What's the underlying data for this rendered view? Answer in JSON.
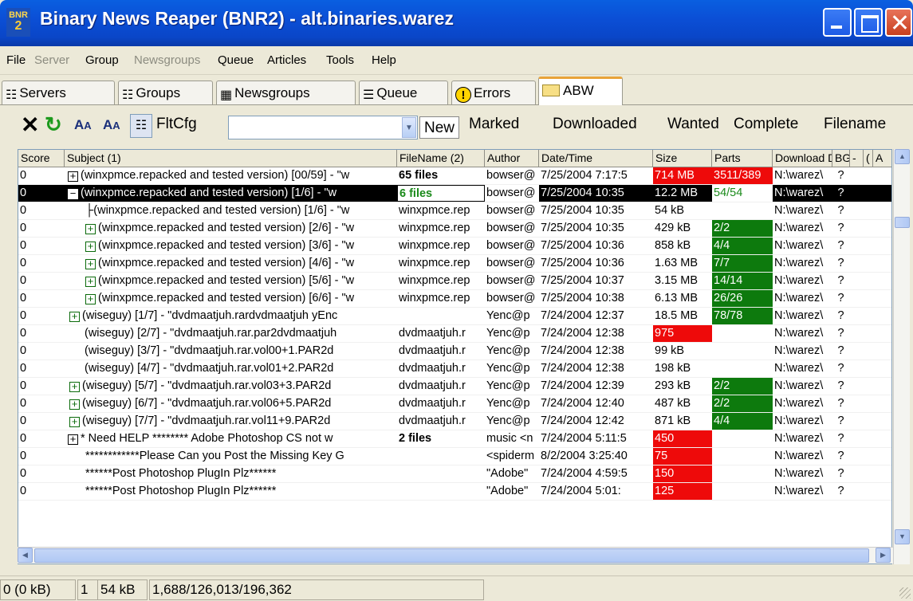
{
  "window": {
    "title": "Binary News Reaper (BNR2) - alt.binaries.warez",
    "icon_text_top": "BNR",
    "icon_text_bottom": "2"
  },
  "menu": [
    {
      "label": "File",
      "disabled": false
    },
    {
      "label": "Server",
      "disabled": true
    },
    {
      "label": "Group",
      "disabled": false
    },
    {
      "label": "Newsgroups",
      "disabled": true
    },
    {
      "label": "Queue",
      "disabled": false
    },
    {
      "label": "Articles",
      "disabled": false
    },
    {
      "label": "Tools",
      "disabled": false
    },
    {
      "label": "Help",
      "disabled": false
    }
  ],
  "tabs": [
    {
      "label": "Servers",
      "icon": "servers-icon"
    },
    {
      "label": "Groups",
      "icon": "groups-icon"
    },
    {
      "label": "Newsgroups",
      "icon": "newsgroups-icon"
    },
    {
      "label": "Queue",
      "icon": "queue-icon"
    },
    {
      "label": "Errors",
      "icon": "error-icon"
    },
    {
      "label": "ABW",
      "icon": "folder-icon",
      "active": true
    }
  ],
  "toolbar": {
    "filter_config_label": "FltCfg",
    "filter_value": "",
    "new_label": "New",
    "filters": [
      "Marked",
      "Downloaded",
      "Wanted",
      "Complete",
      "Filename"
    ]
  },
  "grid": {
    "columns": [
      "Score",
      "Subject (1)",
      "FileName (2)",
      "Author",
      "Date/Time",
      "Size",
      "Parts",
      "Download D",
      "BG",
      "-",
      "(",
      "A"
    ],
    "rows": [
      {
        "score": "0",
        "subject": "(winxpmce.repacked and tested version) [00/59] - \"w",
        "expander": "+",
        "filename": "65 files",
        "author": "bowser@",
        "date": "7/25/2004 7:17:5",
        "size": "714 MB",
        "size_color": "red",
        "parts": "3511/389",
        "parts_color": "red",
        "dl": "N:\\warez\\",
        "bg": "?"
      },
      {
        "score": "0",
        "subject": "(winxpmce.repacked and tested version) [1/6] - \"w",
        "expander": "-",
        "filename": "6 files",
        "author": "bowser@",
        "date": "7/25/2004 10:35",
        "size": "12.2 MB",
        "size_color": "",
        "parts": "54/54",
        "parts_color": "",
        "dl": "N:\\warez\\",
        "bg": "?",
        "selected": true
      },
      {
        "score": "0",
        "subject": "(winxpmce.repacked and tested version) [1/6] - \"w",
        "expander": "",
        "filename": "winxpmce.rep",
        "author": "bowser@",
        "date": "7/25/2004 10:35",
        "size": "54 kB",
        "size_color": "",
        "parts": "",
        "parts_color": "",
        "dl": "N:\\warez\\",
        "bg": "?"
      },
      {
        "score": "0",
        "subject": "(winxpmce.repacked and tested version) [2/6] - \"w",
        "expander": "+",
        "filename": "winxpmce.rep",
        "author": "bowser@",
        "date": "7/25/2004 10:35",
        "size": "429 kB",
        "size_color": "",
        "parts": "2/2",
        "parts_color": "green",
        "dl": "N:\\warez\\",
        "bg": "?"
      },
      {
        "score": "0",
        "subject": "(winxpmce.repacked and tested version) [3/6] - \"w",
        "expander": "+",
        "filename": "winxpmce.rep",
        "author": "bowser@",
        "date": "7/25/2004 10:36",
        "size": "858 kB",
        "size_color": "",
        "parts": "4/4",
        "parts_color": "green",
        "dl": "N:\\warez\\",
        "bg": "?"
      },
      {
        "score": "0",
        "subject": "(winxpmce.repacked and tested version) [4/6] - \"w",
        "expander": "+",
        "filename": "winxpmce.rep",
        "author": "bowser@",
        "date": "7/25/2004 10:36",
        "size": "1.63 MB",
        "size_color": "",
        "parts": "7/7",
        "parts_color": "green",
        "dl": "N:\\warez\\",
        "bg": "?"
      },
      {
        "score": "0",
        "subject": "(winxpmce.repacked and tested version) [5/6] - \"w",
        "expander": "+",
        "filename": "winxpmce.rep",
        "author": "bowser@",
        "date": "7/25/2004 10:37",
        "size": "3.15 MB",
        "size_color": "",
        "parts": "14/14",
        "parts_color": "green",
        "dl": "N:\\warez\\",
        "bg": "?"
      },
      {
        "score": "0",
        "subject": "(winxpmce.repacked and tested version) [6/6] - \"w",
        "expander": "+",
        "filename": "winxpmce.rep",
        "author": "bowser@",
        "date": "7/25/2004 10:38",
        "size": "6.13 MB",
        "size_color": "",
        "parts": "26/26",
        "parts_color": "green",
        "dl": "N:\\warez\\",
        "bg": "?"
      },
      {
        "score": "0",
        "subject": "(wiseguy) [1/7] - \"dvdmaatjuh.rardvdmaatjuh yEnc",
        "expander": "+",
        "filename": "",
        "author": "Yenc@p",
        "date": "7/24/2004 12:37",
        "size": "18.5 MB",
        "size_color": "",
        "parts": "78/78",
        "parts_color": "green",
        "dl": "N:\\warez\\",
        "bg": "?"
      },
      {
        "score": "0",
        "subject": "(wiseguy) [2/7] - \"dvdmaatjuh.rar.par2dvdmaatjuh",
        "expander": "",
        "filename": "dvdmaatjuh.r",
        "author": "Yenc@p",
        "date": "7/24/2004 12:38",
        "size": "975",
        "size_color": "red",
        "parts": "",
        "parts_color": "",
        "dl": "N:\\warez\\",
        "bg": "?"
      },
      {
        "score": "0",
        "subject": "(wiseguy) [3/7] - \"dvdmaatjuh.rar.vol00+1.PAR2d",
        "expander": "",
        "filename": "dvdmaatjuh.r",
        "author": "Yenc@p",
        "date": "7/24/2004 12:38",
        "size": "99 kB",
        "size_color": "",
        "parts": "",
        "parts_color": "",
        "dl": "N:\\warez\\",
        "bg": "?"
      },
      {
        "score": "0",
        "subject": "(wiseguy) [4/7] - \"dvdmaatjuh.rar.vol01+2.PAR2d",
        "expander": "",
        "filename": "dvdmaatjuh.r",
        "author": "Yenc@p",
        "date": "7/24/2004 12:38",
        "size": "198 kB",
        "size_color": "",
        "parts": "",
        "parts_color": "",
        "dl": "N:\\warez\\",
        "bg": "?"
      },
      {
        "score": "0",
        "subject": "(wiseguy) [5/7] - \"dvdmaatjuh.rar.vol03+3.PAR2d",
        "expander": "+",
        "filename": "dvdmaatjuh.r",
        "author": "Yenc@p",
        "date": "7/24/2004 12:39",
        "size": "293 kB",
        "size_color": "",
        "parts": "2/2",
        "parts_color": "green",
        "dl": "N:\\warez\\",
        "bg": "?"
      },
      {
        "score": "0",
        "subject": "(wiseguy) [6/7] - \"dvdmaatjuh.rar.vol06+5.PAR2d",
        "expander": "+",
        "filename": "dvdmaatjuh.r",
        "author": "Yenc@p",
        "date": "7/24/2004 12:40",
        "size": "487 kB",
        "size_color": "",
        "parts": "2/2",
        "parts_color": "green",
        "dl": "N:\\warez\\",
        "bg": "?"
      },
      {
        "score": "0",
        "subject": "(wiseguy) [7/7] - \"dvdmaatjuh.rar.vol11+9.PAR2d",
        "expander": "+",
        "filename": "dvdmaatjuh.r",
        "author": "Yenc@p",
        "date": "7/24/2004 12:42",
        "size": "871 kB",
        "size_color": "",
        "parts": "4/4",
        "parts_color": "green",
        "dl": "N:\\warez\\",
        "bg": "?"
      },
      {
        "score": "0",
        "subject": "* Need HELP ******** Adobe Photoshop CS not w",
        "expander": "+",
        "filename": "2 files",
        "author": "music <n",
        "date": "7/24/2004 5:11:5",
        "size": "450",
        "size_color": "red",
        "parts": "",
        "parts_color": "",
        "dl": "N:\\warez\\",
        "bg": "?"
      },
      {
        "score": "0",
        "subject": "************Please Can you Post the Missing Key G",
        "expander": "",
        "filename": "",
        "author": "<spiderm",
        "date": "8/2/2004 3:25:40",
        "size": "75",
        "size_color": "red",
        "parts": "",
        "parts_color": "",
        "dl": "N:\\warez\\",
        "bg": "?"
      },
      {
        "score": "0",
        "subject": "******Post Photoshop PlugIn Plz******",
        "expander": "",
        "filename": "",
        "author": "\"Adobe\"",
        "date": "7/24/2004 4:59:5",
        "size": "150",
        "size_color": "red",
        "parts": "",
        "parts_color": "",
        "dl": "N:\\warez\\",
        "bg": "?"
      },
      {
        "score": "0",
        "subject": "******Post Photoshop PlugIn Plz******",
        "expander": "",
        "filename": "",
        "author": "\"Adobe\"",
        "date": "7/24/2004 5:01:",
        "size": "125",
        "size_color": "red",
        "parts": "",
        "parts_color": "",
        "dl": "N:\\warez\\",
        "bg": "?"
      }
    ]
  },
  "status": {
    "panel1": "0 (0 kB)",
    "panel2": "1",
    "panel3": "54 kB",
    "panel4": "1,688/126,013/196,362"
  }
}
